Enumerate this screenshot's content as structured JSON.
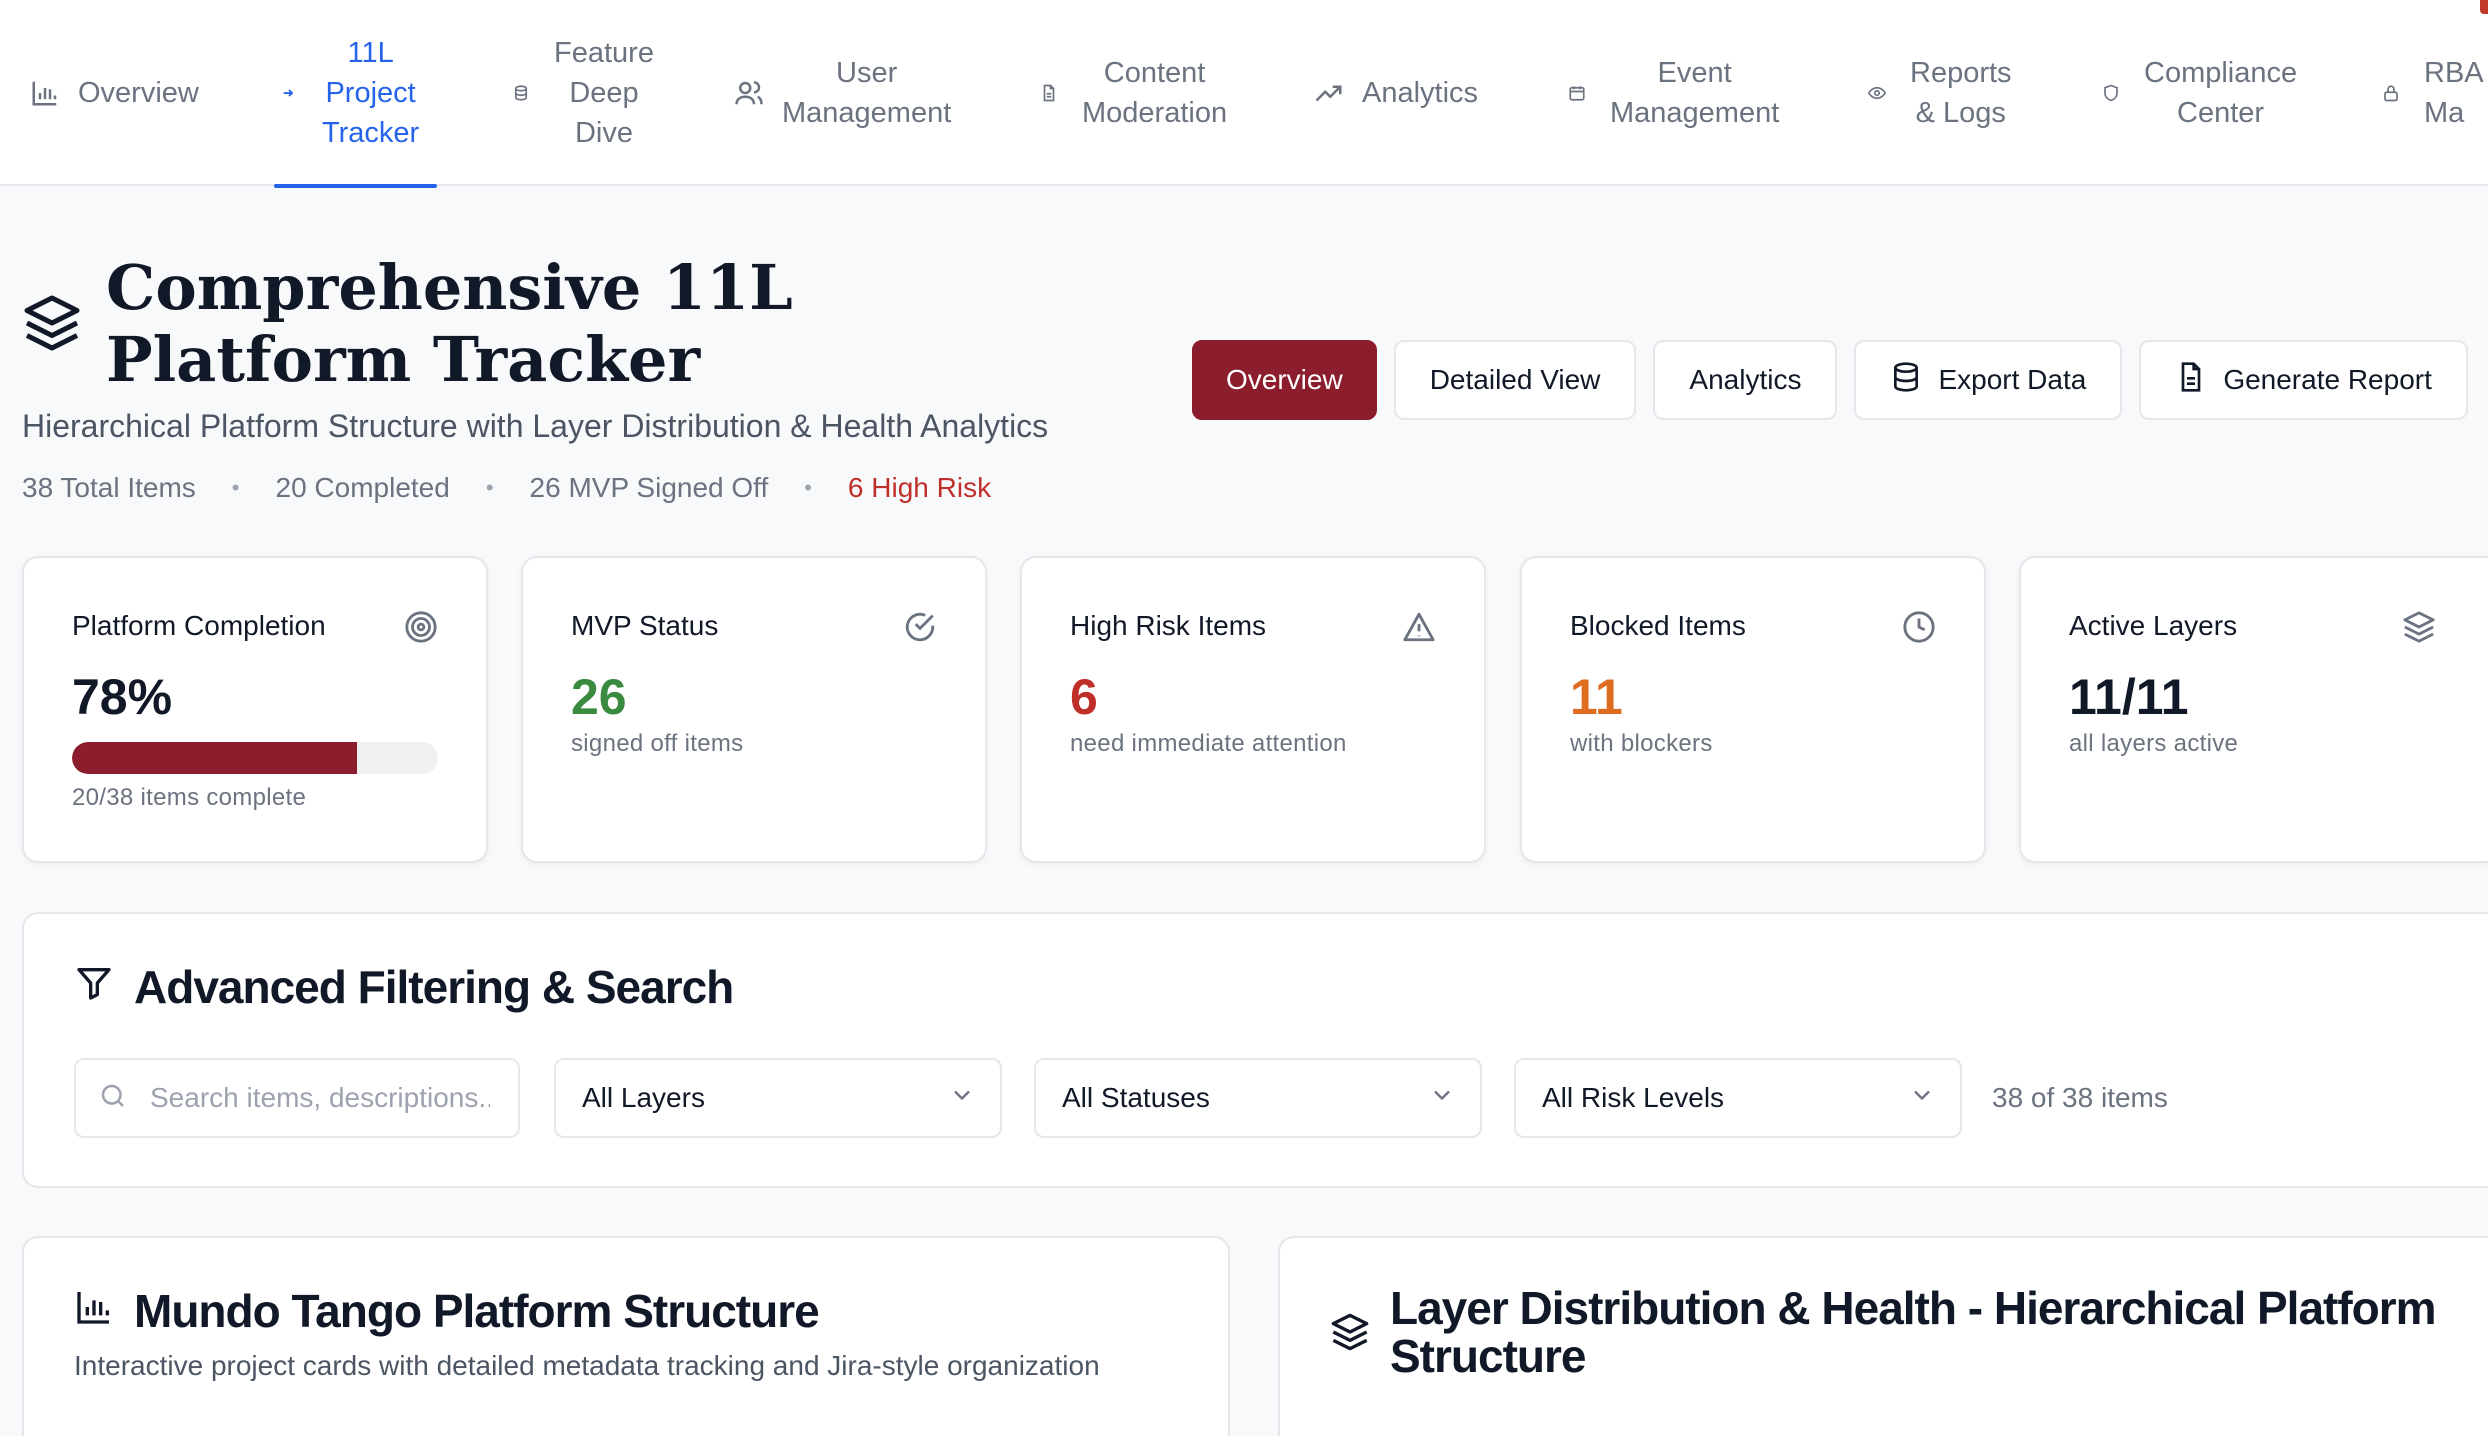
{
  "nav": {
    "items": [
      {
        "label": "Overview",
        "icon": "bar-chart-icon",
        "active": false
      },
      {
        "label": "11L\nProject\nTracker",
        "icon": "small-arrow-icon",
        "active": true
      },
      {
        "label": "Feature\nDeep\nDive",
        "icon": "database-icon",
        "active": false
      },
      {
        "label": "User\nManagement",
        "icon": "users-icon",
        "active": false
      },
      {
        "label": "Content\nModeration",
        "icon": "file-icon",
        "active": false
      },
      {
        "label": "Analytics",
        "icon": "trending-up-icon",
        "active": false
      },
      {
        "label": "Event\nManagement",
        "icon": "calendar-icon",
        "active": false
      },
      {
        "label": "Reports\n& Logs",
        "icon": "eye-icon",
        "active": false
      },
      {
        "label": "Compliance\nCenter",
        "icon": "shield-icon",
        "active": false
      },
      {
        "label": "RBA\nMa",
        "icon": "lock-icon",
        "active": false
      }
    ]
  },
  "header": {
    "title": "Comprehensive 11L Platform Tracker",
    "subtitle": "Hierarchical Platform Structure with Layer Distribution & Health Analytics",
    "meta": {
      "total": "38 Total Items",
      "completed": "20 Completed",
      "mvp": "26 MVP Signed Off",
      "risk": "6 High Risk"
    },
    "actions": {
      "overview": "Overview",
      "detailed": "Detailed View",
      "analytics": "Analytics",
      "export": "Export Data",
      "report": "Generate Report"
    }
  },
  "stats": {
    "completion": {
      "title": "Platform Completion",
      "value": "78%",
      "progress": 0.78,
      "sub": "20/38 items complete"
    },
    "mvp": {
      "title": "MVP Status",
      "value": "26",
      "sub": "signed off items"
    },
    "risk": {
      "title": "High Risk Items",
      "value": "6",
      "sub": "need immediate attention"
    },
    "blocked": {
      "title": "Blocked Items",
      "value": "11",
      "sub": "with blockers"
    },
    "layers": {
      "title": "Active Layers",
      "value": "11/11",
      "sub": "all layers active"
    }
  },
  "filters": {
    "title": "Advanced Filtering & Search",
    "search_placeholder": "Search items, descriptions...",
    "layers": "All Layers",
    "statuses": "All Statuses",
    "risk": "All Risk Levels",
    "count": "38 of 38 items"
  },
  "panels": {
    "structure": {
      "title": "Mundo Tango Platform Structure",
      "subtitle": "Interactive project cards with detailed metadata tracking and Jira-style organization"
    },
    "distribution": {
      "title": "Layer Distribution & Health - Hierarchical Platform Structure"
    }
  },
  "colors": {
    "accent": "#8b1d2c",
    "active_nav": "#2563eb",
    "success": "#3a8a3f",
    "danger": "#c0302b",
    "warning": "#dd6b20"
  }
}
